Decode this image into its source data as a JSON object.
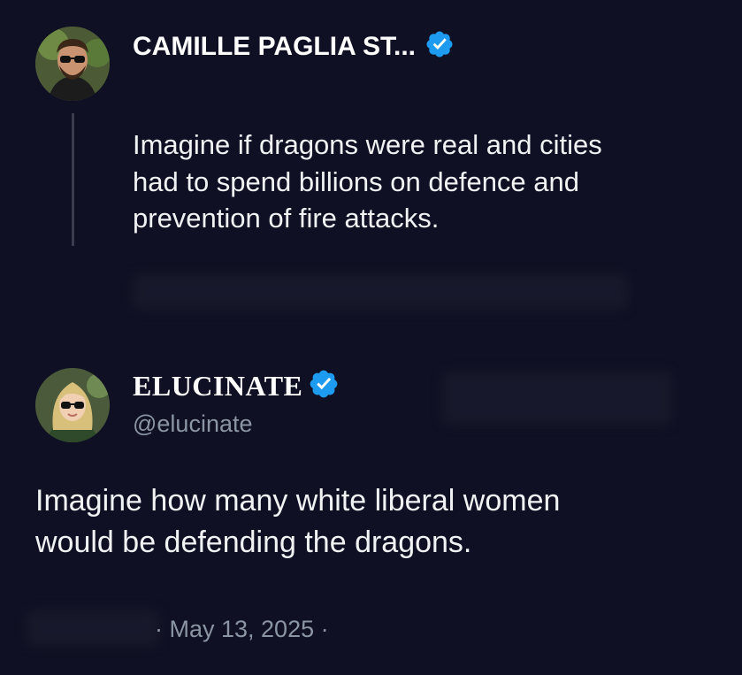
{
  "parent_tweet": {
    "display_name": "CAMILLE PAGLIA ST...",
    "verified_icon": "verified-badge-icon",
    "text_lines": [
      "Imagine if dragons were real and cities",
      "had to spend billions on defence and",
      "prevention of fire attacks."
    ]
  },
  "reply_tweet": {
    "display_name": "ELUCINATE",
    "handle": "@elucinate",
    "verified_icon": "verified-badge-icon",
    "text_lines": [
      "Imagine how many white liberal women",
      "would be defending the dragons."
    ],
    "timestamp": "· May 13, 2025 ·"
  },
  "colors": {
    "background": "#0f1023",
    "verified": "#1d9bf0",
    "secondary_text": "#8b95a3",
    "primary_text": "#f1f2f4"
  }
}
